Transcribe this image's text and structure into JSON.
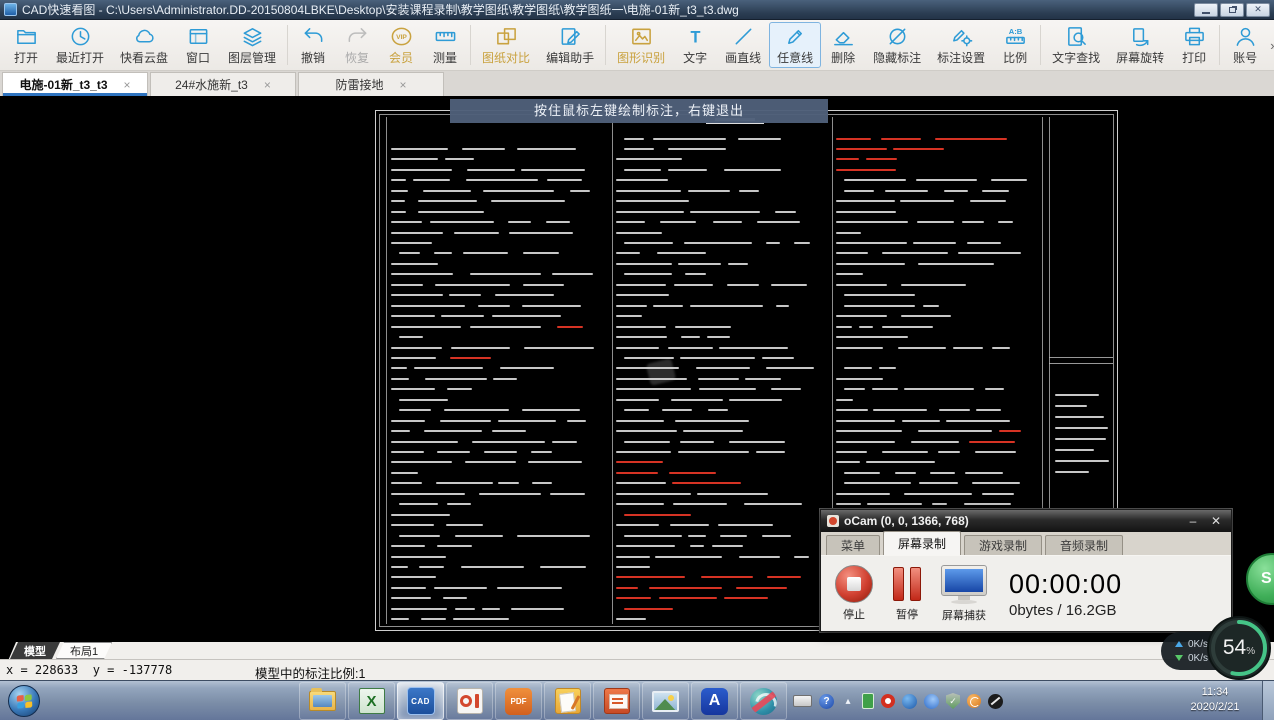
{
  "window": {
    "title": "CAD快速看图 - C:\\Users\\Administrator.DD-20150804LBKE\\Desktop\\安装课程录制\\教学图纸\\教学图纸\\教学图纸一\\电施-01新_t3_t3.dwg"
  },
  "toolbar": {
    "overflow_label": "»",
    "buttons": [
      {
        "id": "open",
        "label": "打开",
        "icon": "folder"
      },
      {
        "id": "recent-open",
        "label": "最近打开",
        "icon": "recent"
      },
      {
        "id": "cloud-drive",
        "label": "快看云盘",
        "icon": "cloud"
      },
      {
        "id": "window",
        "label": "窗口",
        "icon": "window"
      },
      {
        "id": "layer-manager",
        "label": "图层管理",
        "icon": "layers",
        "sep_after": true
      },
      {
        "id": "undo",
        "label": "撤销",
        "icon": "undo"
      },
      {
        "id": "redo",
        "label": "恢复",
        "icon": "redo",
        "disabled": true
      },
      {
        "id": "vip",
        "label": "会员",
        "icon": "vip",
        "gold": true
      },
      {
        "id": "measure",
        "label": "测量",
        "icon": "measure",
        "sep_after": true
      },
      {
        "id": "drawing-compare",
        "label": "图纸对比",
        "icon": "compare",
        "gold": true
      },
      {
        "id": "edit-assistant",
        "label": "编辑助手",
        "icon": "edit",
        "sep_after": true
      },
      {
        "id": "shape-recognition",
        "label": "图形识别",
        "icon": "recognize",
        "gold": true
      },
      {
        "id": "text",
        "label": "文字",
        "icon": "text"
      },
      {
        "id": "draw-line",
        "label": "画直线",
        "icon": "line"
      },
      {
        "id": "freehand-line",
        "label": "任意线",
        "icon": "pencil",
        "active": true
      },
      {
        "id": "delete",
        "label": "删除",
        "icon": "eraser"
      },
      {
        "id": "hide-annotations",
        "label": "隐藏标注",
        "icon": "eyeslash"
      },
      {
        "id": "annotation-settings",
        "label": "标注设置",
        "icon": "pencilgear"
      },
      {
        "id": "scale",
        "label": "比例",
        "icon": "scale",
        "sep_after": true
      },
      {
        "id": "find-text",
        "label": "文字查找",
        "icon": "find"
      },
      {
        "id": "screen-rotate",
        "label": "屏幕旋转",
        "icon": "rotate"
      },
      {
        "id": "print",
        "label": "打印",
        "icon": "print",
        "sep_after": true
      },
      {
        "id": "account",
        "label": "账号",
        "icon": "user"
      }
    ]
  },
  "doc_tabs": {
    "close_label": "×",
    "tabs": [
      {
        "label": "电施-01新_t3_t3",
        "active": true
      },
      {
        "label": "24#水施新_t3",
        "active": false
      },
      {
        "label": "防雷接地",
        "active": false
      }
    ]
  },
  "hint_bar": {
    "text": "按住鼠标左键绘制标注，右键退出"
  },
  "ocam": {
    "title": "oCam (0, 0, 1366, 768)",
    "minimize_label": "–",
    "close_label": "✕",
    "tabs": [
      {
        "label": "菜单",
        "active": false
      },
      {
        "label": "屏幕录制",
        "active": true
      },
      {
        "label": "游戏录制",
        "active": false
      },
      {
        "label": "音频录制",
        "active": false
      }
    ],
    "stop_label": "停止",
    "pause_label": "暂停",
    "capture_label": "屏幕捕获",
    "timer": "00:00:00",
    "size_info": "0bytes / 16.2GB"
  },
  "model_tabs": {
    "model": "模型",
    "layout": "布局1"
  },
  "status_bar": {
    "coordinates": "x = 228633  y = -137778",
    "scale_text": "模型中的标注比例:1"
  },
  "net_widget": {
    "upload": "0K/s",
    "download": "0K/s"
  },
  "memory_widget": {
    "percent": "54",
    "unit": "%"
  },
  "speed_ball": {
    "label": "S"
  },
  "taskbar": {
    "apps": [
      {
        "id": "explorer"
      },
      {
        "id": "excel",
        "glyph": "X"
      },
      {
        "id": "cad-viewer",
        "glyph": "CAD",
        "active": true
      },
      {
        "id": "ocam-app"
      },
      {
        "id": "pdf-reader",
        "glyph": "PDF"
      },
      {
        "id": "wps-note"
      },
      {
        "id": "presentation"
      },
      {
        "id": "image-viewer"
      },
      {
        "id": "a-app",
        "glyph": "A"
      },
      {
        "id": "swirl-app"
      }
    ],
    "tray": [
      {
        "id": "keyboard"
      },
      {
        "id": "help",
        "glyph": "?"
      },
      {
        "id": "expand",
        "glyph": "▴"
      },
      {
        "id": "usb"
      },
      {
        "id": "record"
      },
      {
        "id": "im"
      },
      {
        "id": "browser"
      },
      {
        "id": "safety",
        "glyph": "✓"
      },
      {
        "id": "update"
      },
      {
        "id": "antenna"
      }
    ],
    "clock": {
      "time": "11:34",
      "date": "2020/2/21"
    }
  },
  "colors": {
    "accent_blue": "#2e9bd6",
    "gold": "#c9a23f",
    "annotation_red": "#d63324",
    "ocam_screen_blue": "#2f6fd0",
    "taskbar_blue_gray": "#7c8ea8"
  }
}
